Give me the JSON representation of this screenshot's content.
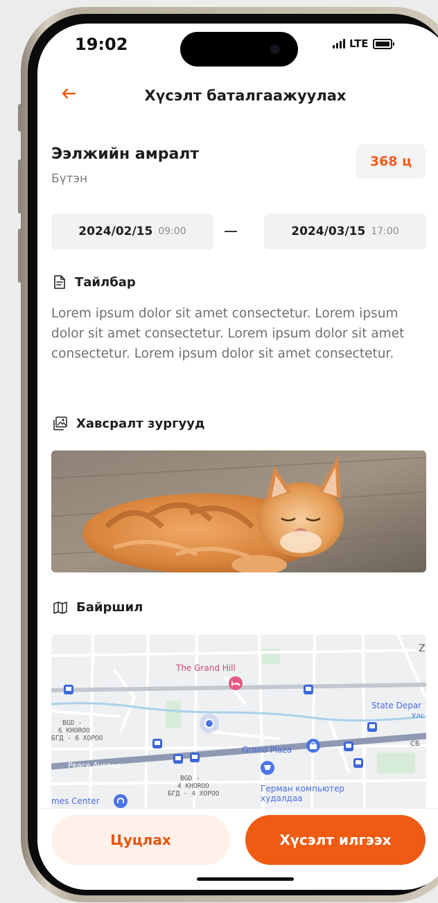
{
  "status_bar": {
    "time": "19:02",
    "network": "LTE"
  },
  "header": {
    "title": "Хүсэлт баталгаажуулах"
  },
  "request": {
    "name": "Ээлжийн амралт",
    "subtitle": "Бүтэн",
    "duration": "368 ц"
  },
  "dates": {
    "start_date": "2024/02/15",
    "start_time": "09:00",
    "end_date": "2024/03/15",
    "end_time": "17:00"
  },
  "description": {
    "heading": "Тайлбар",
    "text": "Lorem ipsum dolor sit amet consectetur. Lorem ipsum dolor sit amet consectetur. Lorem ipsum dolor sit amet consectetur. Lorem ipsum dolor sit amet consectetur."
  },
  "attachments": {
    "heading": "Хавсралт зургууд"
  },
  "location": {
    "heading": "Байршил",
    "map_labels": {
      "poi_hotel": "The Grand Hill",
      "poi_store": "State Depar",
      "poi_store_sub": "Улс",
      "poi_plaza": "Grand Plaza",
      "district_a_1": "BGD -",
      "district_a_2": "6 KHOROO",
      "district_a_3": "БГД - 6 ХОРОО",
      "district_b_1": "BGD -",
      "district_b_2": "4 KHOROO",
      "district_b_3": "БГД - 4 ХОРОО",
      "road": "Peace Avenue",
      "poi_computer_1": "Герман компьютер",
      "poi_computer_2": "худалдаа",
      "poi_center": "mes Center",
      "edge_z": "Z",
      "edge_c": "СБ"
    }
  },
  "actions": {
    "cancel": "Цуцлах",
    "submit": "Хүсэлт илгээх"
  },
  "colors": {
    "accent": "#EF5B12",
    "accent_light": "#FDF1EA",
    "text": "#1E1E1E",
    "muted": "#7A7A7A"
  },
  "icons": [
    "back-arrow-icon",
    "signal-icon",
    "battery-icon",
    "document-icon",
    "image-icon",
    "map-icon"
  ]
}
